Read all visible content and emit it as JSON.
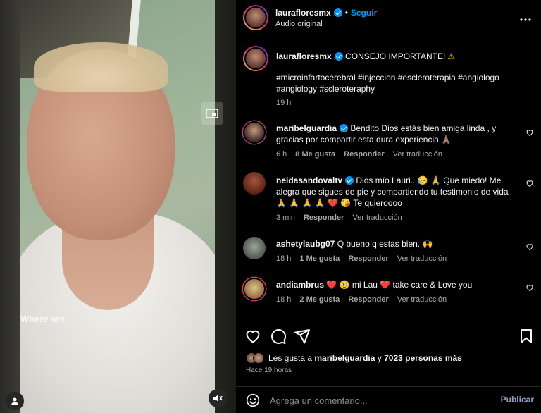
{
  "media": {
    "caption_text": "Where are"
  },
  "header": {
    "username": "laurafloresmx",
    "separator": "•",
    "follow_label": "Seguir",
    "audio_label": "Audio original",
    "more_icon": "more-horizontal-icon"
  },
  "post": {
    "username": "laurafloresmx",
    "text": "CONSEJO IMPORTANTE!",
    "hashtags": "#microinfartocerebral #injeccion #escleroterapia #angiologo #angiology #scleroteraphy",
    "time": "19 h"
  },
  "comments": [
    {
      "username": "maribelguardia",
      "verified": true,
      "text": "Bendito Dios estás bien amiga linda , y gracias por compartir esta dura experiencia 🙏🏽",
      "time": "6 h",
      "likes": "8 Me gusta",
      "reply": "Responder",
      "translate": "Ver traducción"
    },
    {
      "username": "neidasandovaltv",
      "verified": true,
      "text": "Dios mío Lauri.. 😥 🙏 Que miedo! Me alegra que sigues de pie y compartiendo tu testimonio de vida 🙏 🙏 🙏 🙏 ❤️ 😘 Te quieroooo",
      "time": "3 min",
      "likes": "",
      "reply": "Responder",
      "translate": "Ver traducción"
    },
    {
      "username": "ashetylaubg07",
      "verified": false,
      "text": "Q bueno q estas bien. 🙌",
      "time": "18 h",
      "likes": "1 Me gusta",
      "reply": "Responder",
      "translate": "Ver traducción"
    },
    {
      "username": "andiambrus",
      "verified": false,
      "text": "❤️ 🥹 mi Lau ❤️ take care & Love you",
      "time": "18 h",
      "likes": "2 Me gusta",
      "reply": "Responder",
      "translate": "Ver traducción"
    }
  ],
  "likes_line": {
    "prefix": "Les gusta a",
    "user": "maribelguardia",
    "conj": "y",
    "count": "7023 personas más"
  },
  "posted_ago": "Hace 19 horas",
  "comment_bar": {
    "placeholder": "Agrega un comentario...",
    "publish_label": "Publicar"
  },
  "colors": {
    "accent": "#0095f6",
    "like_heart": "#ed4956",
    "background": "#000000",
    "muted_text": "#a8a8a8"
  }
}
